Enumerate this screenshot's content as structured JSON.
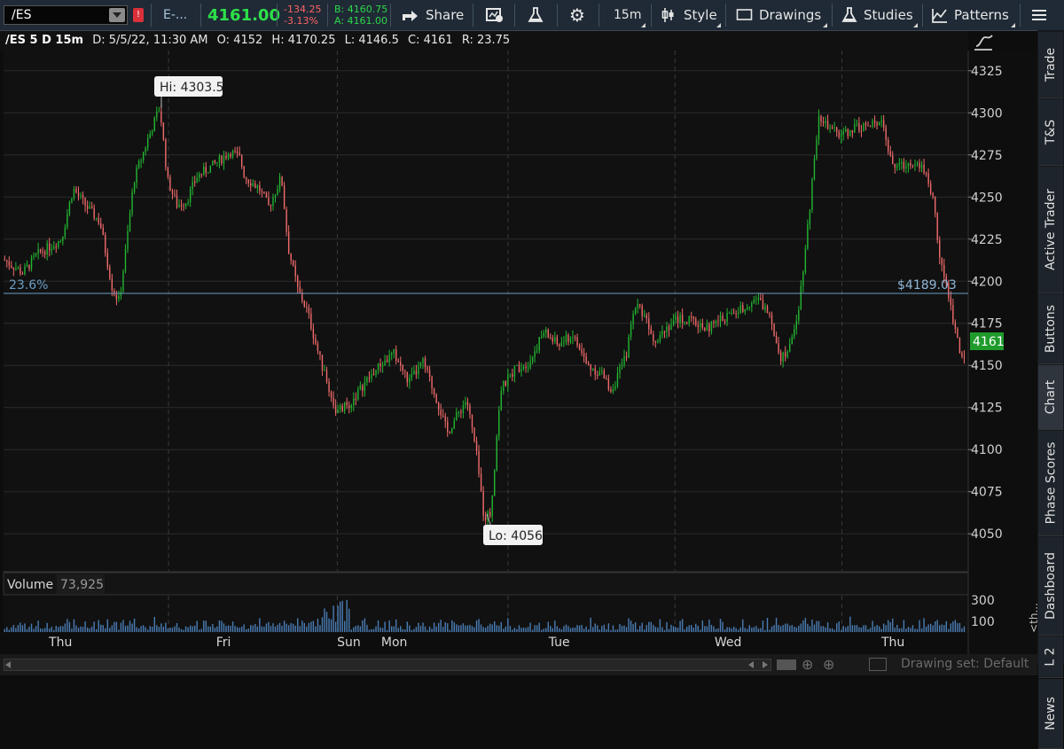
{
  "toolbar": {
    "symbol": "/ES",
    "description": "E-...",
    "last_price": "4161.00",
    "net_change": "-134.25",
    "pct_change": "-3.13%",
    "bid": "B: 4160.75",
    "ask": "A: 4161.00",
    "share_label": "Share",
    "timeframe_label": "15m",
    "style_label": "Style",
    "drawings_label": "Drawings",
    "studies_label": "Studies",
    "patterns_label": "Patterns"
  },
  "info_bar": {
    "symbol": "/ES 5 D 15m",
    "date": "D: 5/5/22, 11:30 AM",
    "open": "O: 4152",
    "high": "H: 4170.25",
    "low": "L: 4146.5",
    "close": "C: 4161",
    "range": "R: 23.75"
  },
  "annotations": {
    "high_label": "Hi: 4303.5",
    "low_label": "Lo: 4056",
    "fib_label": "23.6%",
    "fib_price": "$4189.03",
    "current_price": "4161"
  },
  "volume_panel": {
    "title": "Volume",
    "value": "73,925",
    "axis_labels": [
      "300",
      "100"
    ]
  },
  "colors": {
    "up": "#22b531",
    "down": "#f06a6a",
    "fib_line": "#6b9ec5",
    "current_price_bg": "#1f9b2c"
  },
  "chart_data": {
    "type": "candlestick",
    "y_axis_labels": [
      "4325",
      "4300",
      "4275",
      "4250",
      "4225",
      "4200",
      "4175",
      "4150",
      "4125",
      "4100",
      "4075",
      "4050"
    ],
    "ylim": [
      4028,
      4337
    ],
    "x_tick_labels": [
      "Thu",
      "Fri",
      "Sun",
      "Mon",
      "Tue",
      "Wed",
      "Thu"
    ],
    "grid": true,
    "series": [
      {
        "values": [
          [
            0.0,
            4213
          ],
          [
            2.0,
            4205
          ],
          [
            3.5,
            4216
          ],
          [
            6.0,
            4225
          ],
          [
            7.2,
            4255
          ],
          [
            8.5,
            4245
          ],
          [
            10.0,
            4235
          ],
          [
            11.3,
            4195
          ],
          [
            12.0,
            4188
          ],
          [
            12.8,
            4225
          ],
          [
            13.5,
            4260
          ],
          [
            15.0,
            4285
          ],
          [
            16.2,
            4303.5
          ],
          [
            17.0,
            4260
          ],
          [
            18.0,
            4245
          ],
          [
            19.0,
            4248
          ],
          [
            20.0,
            4262
          ],
          [
            22.0,
            4270
          ],
          [
            23.5,
            4277
          ],
          [
            24.5,
            4273
          ],
          [
            25.0,
            4262
          ],
          [
            26.5,
            4255
          ],
          [
            27.5,
            4244
          ],
          [
            28.8,
            4262
          ],
          [
            29.5,
            4220
          ],
          [
            30.5,
            4195
          ],
          [
            31.5,
            4182
          ],
          [
            32.5,
            4160
          ],
          [
            33.5,
            4140
          ],
          [
            34.5,
            4122
          ],
          [
            36.0,
            4128
          ],
          [
            37.5,
            4140
          ],
          [
            39.0,
            4150
          ],
          [
            40.5,
            4157
          ],
          [
            42.0,
            4140
          ],
          [
            43.5,
            4152
          ],
          [
            45.0,
            4128
          ],
          [
            46.0,
            4110
          ],
          [
            47.0,
            4120
          ],
          [
            48.0,
            4130
          ],
          [
            49.0,
            4098
          ],
          [
            49.8,
            4060
          ],
          [
            50.5,
            4062
          ],
          [
            51.5,
            4135
          ],
          [
            53.0,
            4148
          ],
          [
            54.5,
            4152
          ],
          [
            56.0,
            4170
          ],
          [
            57.5,
            4162
          ],
          [
            59.0,
            4168
          ],
          [
            60.5,
            4150
          ],
          [
            62.0,
            4145
          ],
          [
            63.0,
            4135
          ],
          [
            64.5,
            4155
          ],
          [
            65.5,
            4187
          ],
          [
            66.5,
            4180
          ],
          [
            67.5,
            4165
          ],
          [
            68.5,
            4172
          ],
          [
            70.0,
            4178
          ],
          [
            71.5,
            4176
          ],
          [
            73.0,
            4172
          ],
          [
            74.5,
            4178
          ],
          [
            76.0,
            4182
          ],
          [
            78.0,
            4190
          ],
          [
            79.5,
            4180
          ],
          [
            80.5,
            4155
          ],
          [
            81.5,
            4160
          ],
          [
            82.5,
            4188
          ],
          [
            83.5,
            4240
          ],
          [
            84.5,
            4300
          ],
          [
            85.5,
            4290
          ],
          [
            87.0,
            4287
          ],
          [
            88.5,
            4292
          ],
          [
            90.0,
            4292
          ],
          [
            91.0,
            4298
          ],
          [
            92.0,
            4270
          ],
          [
            93.0,
            4268
          ],
          [
            94.5,
            4272
          ],
          [
            95.5,
            4266
          ],
          [
            96.5,
            4245
          ],
          [
            97.0,
            4215
          ],
          [
            98.0,
            4190
          ],
          [
            99.0,
            4162
          ],
          [
            99.7,
            4152
          ]
        ]
      }
    ],
    "volume_axis_labels": [
      "300",
      "100"
    ]
  },
  "side_tabs": [
    "Trade",
    "T&S",
    "Active Trader",
    "Buttons",
    "Chart",
    "Phase Scores",
    "Dashboard",
    "L 2",
    "News"
  ],
  "bottom_bar": {
    "drawing_set": "Drawing set: Default"
  }
}
